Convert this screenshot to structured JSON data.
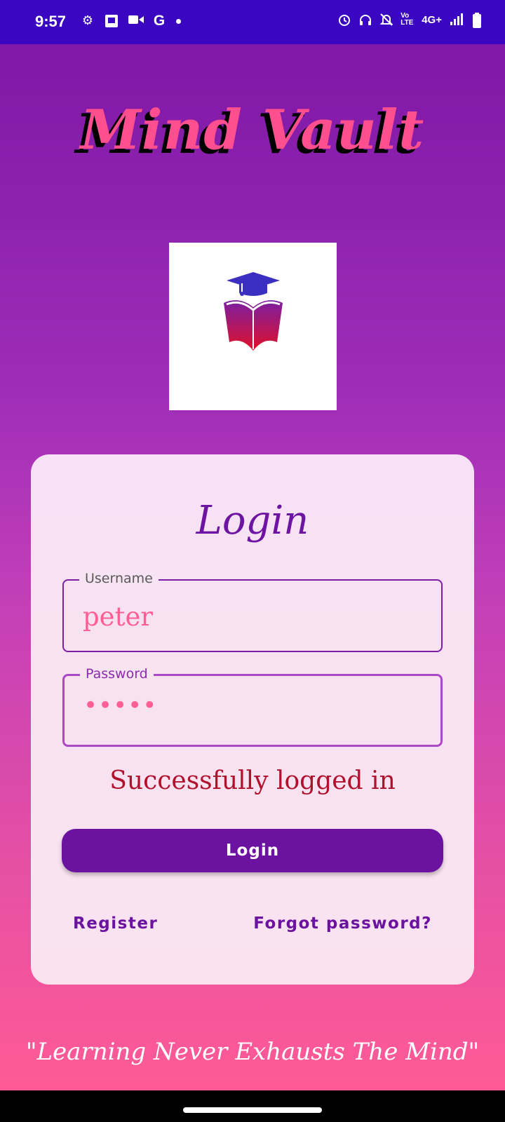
{
  "status_bar": {
    "time": "9:57",
    "left_icons": [
      "settings-icon",
      "app-badge-icon",
      "video-icon",
      "google-icon",
      "dot-icon"
    ],
    "right_icons": [
      "alarm-icon",
      "headphones-icon",
      "mute-icon",
      "volte-icon",
      "network-icon",
      "signal-icon",
      "battery-icon"
    ],
    "volte_label": "Vo LTE",
    "network_label": "4G+"
  },
  "app": {
    "title": "Mind Vault",
    "logo_icon": "graduation-book-icon"
  },
  "login": {
    "title": "Login",
    "username_label": "Username",
    "username_value": "peter",
    "password_label": "Password",
    "password_value": "•••••",
    "status_message": "Successfully logged in",
    "login_button": "Login",
    "register_link": "Register",
    "forgot_link": "Forgot password?"
  },
  "footer": {
    "tagline": "\"Learning Never Exhausts The Mind\""
  },
  "colors": {
    "status_bar_bg": "#3a06c2",
    "accent": "#6b12a1",
    "title_pink": "#ff4f8e",
    "error_red": "#b0112c"
  }
}
